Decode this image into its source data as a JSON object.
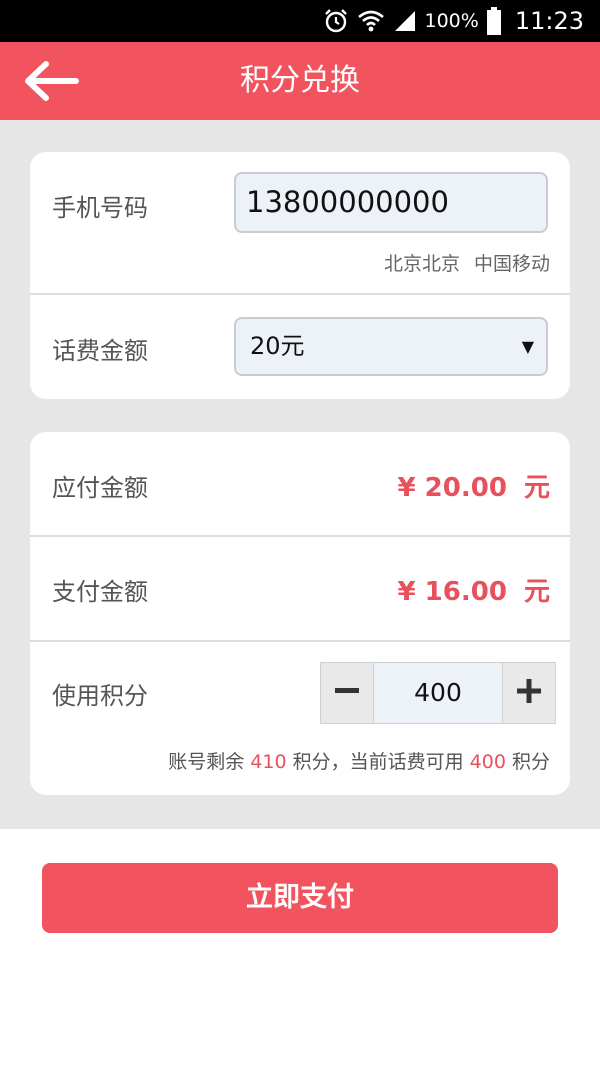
{
  "status_bar": {
    "battery_percent": "100%",
    "time": "11:23",
    "icons": [
      "alarm-icon",
      "wifi-icon",
      "signal-icon",
      "battery-icon"
    ]
  },
  "header": {
    "title": "积分兑换",
    "back_icon": "arrow-left-icon"
  },
  "recharge_card": {
    "phone_label": "手机号码",
    "phone_value": "13800000000",
    "location": "北京北京",
    "carrier": "中国移动",
    "amount_label": "话费金额",
    "amount_selected": "20元"
  },
  "payment_card": {
    "payable_label": "应付金额",
    "payable_currency": "¥",
    "payable_value": "20.00",
    "payable_unit": "元",
    "pay_label": "支付金额",
    "pay_currency": "¥",
    "pay_value": "16.00",
    "pay_unit": "元",
    "points_label": "使用积分",
    "points_value": "400",
    "note_prefix": "账号剩余",
    "remaining_points": "410",
    "note_middle": "积分，当前话费可用",
    "usable_points": "400",
    "note_suffix": "积分"
  },
  "actions": {
    "pay_button_label": "立即支付"
  },
  "colors": {
    "accent": "#f1545f",
    "amount_text": "#e8505b",
    "background_gray": "#e6e6e6"
  }
}
